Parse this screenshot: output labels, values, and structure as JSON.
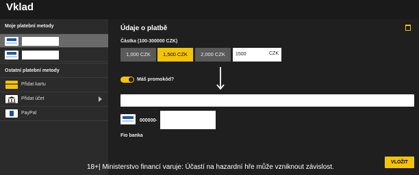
{
  "header": {
    "title": "Vklad"
  },
  "sidebar": {
    "my_methods_heading": "Moje platební metody",
    "other_methods_heading": "Ostatní platební metody",
    "other_methods": [
      {
        "label": "Přidat kartu",
        "icon": "card-icon"
      },
      {
        "label": "Přidat účet",
        "icon": "bank-icon"
      },
      {
        "label": "PayPal",
        "icon": "paypal-icon"
      }
    ]
  },
  "main": {
    "title": "Údaje o platbě",
    "amount_label": "Částka (100-300000 CZK)",
    "amount_options": [
      "1,000 CZK",
      "1,500 CZK",
      "2,000 CZK"
    ],
    "selected_amount_index": 1,
    "amount_input": {
      "value": "1500",
      "currency": "CZK"
    },
    "promo": {
      "label": "Máš promokód?",
      "enabled": true,
      "value": ""
    },
    "account": {
      "number_prefix": "000000-",
      "bank": "Fio banka"
    },
    "submit_label": "VLOŽIT"
  },
  "footer": {
    "warning": "18+| Ministerstvo financí varuje: Účastí na hazardní hře může vzniknout závislost."
  },
  "colors": {
    "accent": "#f5c400",
    "background": "#1f1f1f",
    "sidebar": "#2b2b2b",
    "selected_row": "#6a6a6a"
  }
}
